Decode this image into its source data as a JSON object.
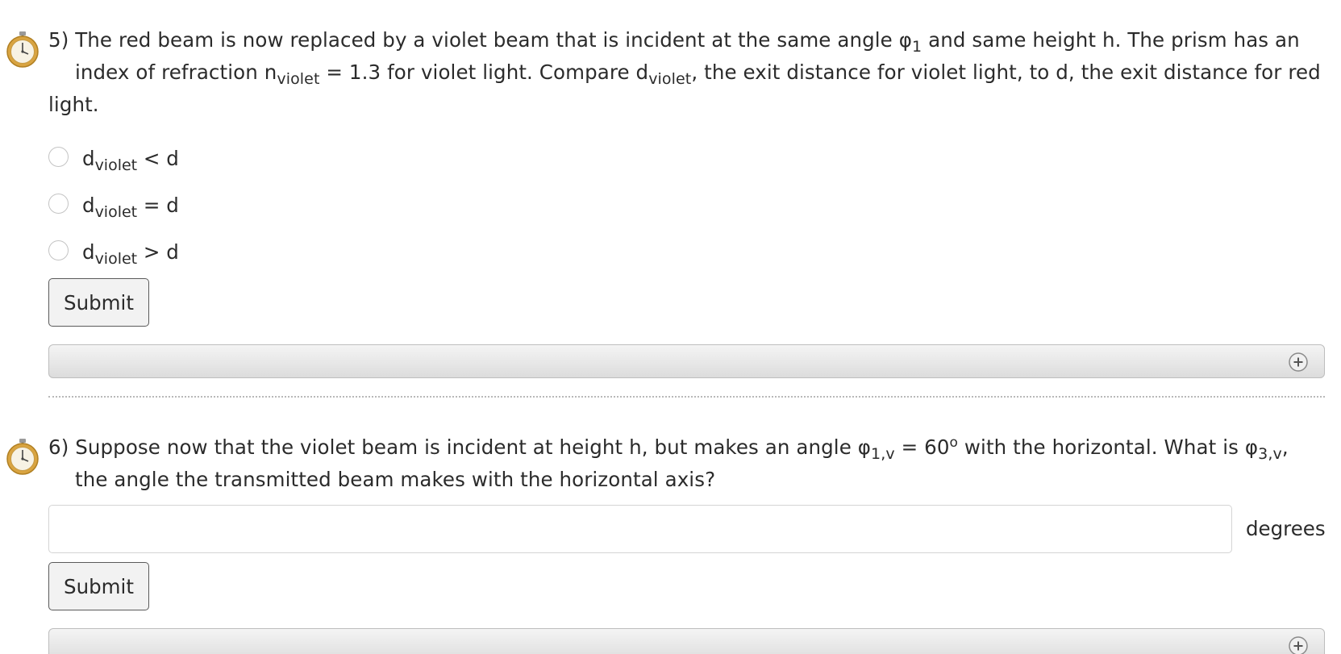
{
  "question5": {
    "line1": {
      "prefix": "5) The red beam is now replaced by a violet beam that is incident at the same angle ",
      "phi": "φ",
      "phi_sub": "1",
      "suffix": " and same height h. The prism has an"
    },
    "line2": {
      "a": "index of refraction n",
      "a_sub": "violet",
      "b": " = 1.3 for violet light. Compare d",
      "b_sub": "violet",
      "c": ", the exit distance for violet light, to d, the exit distance for red"
    },
    "line3": "light.",
    "options": [
      {
        "base": "d",
        "sub": "violet",
        "rest": " < d"
      },
      {
        "base": "d",
        "sub": "violet",
        "rest": " = d"
      },
      {
        "base": "d",
        "sub": "violet",
        "rest": " > d"
      }
    ],
    "submit_label": "Submit"
  },
  "question6": {
    "line1": {
      "a": "6) Suppose now that the violet beam is incident at height h, but makes an angle ",
      "phi1": "φ",
      "phi1_sub": "1,v",
      "b": " = 60",
      "deg": "o",
      "c": " with the horizontal. What is ",
      "phi3": "φ",
      "phi3_sub": "3,v",
      "d": ","
    },
    "line2": "the angle the transmitted beam makes with the horizontal axis?",
    "input_value": "",
    "units": "degrees",
    "submit_label": "Submit"
  },
  "icons": {
    "timer": "stopwatch-icon",
    "expand": "plus-circle-icon"
  },
  "colors": {
    "text": "#2b2b2b",
    "bar": "#e6e6e6",
    "button_bg": "#f2f2f2",
    "stopwatch": "#d9a441"
  }
}
